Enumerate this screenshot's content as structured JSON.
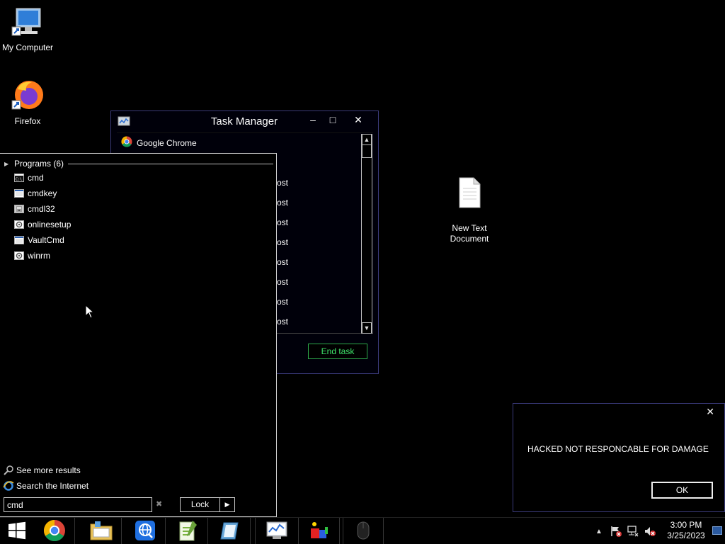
{
  "desktop": {
    "icons": [
      {
        "label": "My Computer"
      },
      {
        "label": "Firefox"
      },
      {
        "label": "New Text\nDocument"
      }
    ]
  },
  "task_manager": {
    "title": "Task Manager",
    "minimize_label": "–",
    "maximize_label": "□",
    "close_label": "✕",
    "rows": [
      {
        "label": "Google Chrome"
      },
      {
        "label": "ost"
      },
      {
        "label": "ost"
      },
      {
        "label": "ost"
      },
      {
        "label": "ost"
      },
      {
        "label": "ost"
      },
      {
        "label": "ost"
      },
      {
        "label": "ost"
      },
      {
        "label": "ost"
      }
    ],
    "end_task_label": "End task"
  },
  "start_menu": {
    "group_label": "Programs (6)",
    "programs": [
      {
        "label": "cmd"
      },
      {
        "label": "cmdkey"
      },
      {
        "label": "cmdl32"
      },
      {
        "label": "onlinesetup"
      },
      {
        "label": "VaultCmd"
      },
      {
        "label": "winrm"
      }
    ],
    "see_more": "See more results",
    "search_internet": "Search the Internet",
    "search_value": "cmd",
    "clear_label": "✖",
    "lock_label": "Lock",
    "lock_arrow": "▶"
  },
  "hack_dialog": {
    "close_label": "✕",
    "message": "HACKED NOT RESPONCABLE FOR DAMAGE",
    "ok_label": "OK"
  },
  "taskbar": {
    "time": "3:00 PM",
    "date": "3/25/2023",
    "tray_arrow": "▲"
  }
}
